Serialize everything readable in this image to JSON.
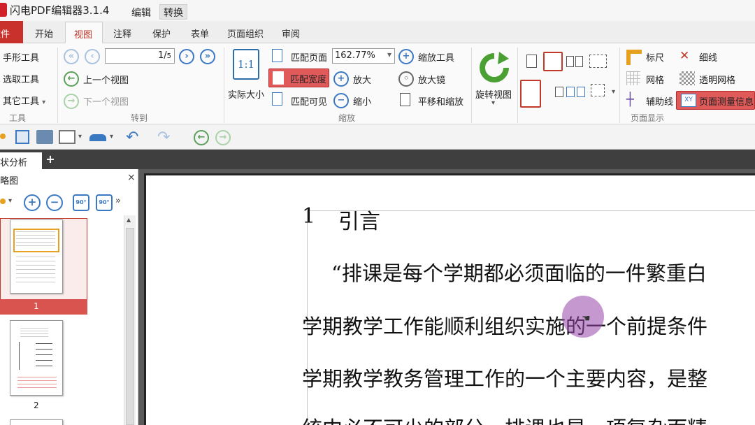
{
  "app": {
    "title": "闪电PDF编辑器3.1.4",
    "menu_edit": "编辑",
    "menu_convert": "转换"
  },
  "tabs": {
    "file": "文件",
    "start": "开始",
    "view": "视图",
    "comment": "注释",
    "protect": "保护",
    "form": "表单",
    "page_org": "页面组织",
    "review": "审阅"
  },
  "ribbon": {
    "tools": {
      "hand": "手形工具",
      "select": "选取工具",
      "other": "其它工具",
      "group": "工具"
    },
    "goto": {
      "page_value": "1",
      "page_total": "5",
      "prev_view": "上一个视图",
      "next_view": "下一个视图",
      "group": "转到"
    },
    "zoom": {
      "actual_size": "实际大小",
      "actual_icon": "1:1",
      "fit_page": "匹配页面",
      "fit_width": "匹配宽度",
      "fit_visible": "匹配可见",
      "zoom_value": "162.77%",
      "zoom_in": "放大",
      "zoom_out": "缩小",
      "zoom_tool": "缩放工具",
      "magnifier": "放大镜",
      "pan_zoom": "平移和缩放",
      "group": "缩放"
    },
    "rotate": {
      "rotate_view": "旋转视图"
    },
    "display": {
      "ruler": "标尺",
      "grid": "网格",
      "guides": "辅助线",
      "thin_line": "细线",
      "transparent_grid": "透明网格",
      "measure_info": "页面测量信息",
      "group": "页面显示"
    }
  },
  "doc_tab": {
    "label": "状分析"
  },
  "thumbnails": {
    "title": "略图",
    "pages": [
      "1",
      "2"
    ]
  },
  "document": {
    "heading_num": "1",
    "heading": "引言",
    "lines": [
      "“排课是每个学期都必须面临的一件繁重白",
      "学期教学工作能顺利组织实施的一个前提条件",
      "学期教学教务管理工作的一个主要内容，是整",
      "统中必不可少的部分。排课也是一项复杂而精"
    ]
  },
  "colors": {
    "accent_red": "#c0392b",
    "accent_blue": "#3a78c2"
  }
}
